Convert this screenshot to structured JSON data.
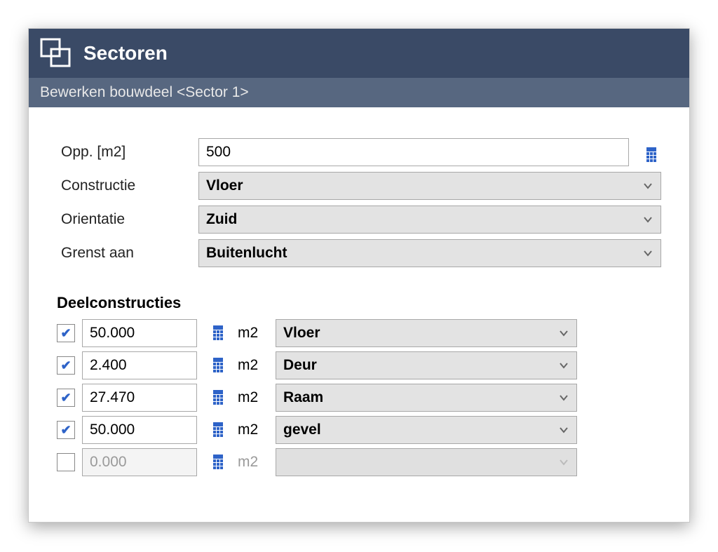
{
  "header": {
    "title": "Sectoren",
    "subtitle": "Bewerken bouwdeel <Sector 1>"
  },
  "form": {
    "opp_label": "Opp. [m2]",
    "opp_value": "500",
    "constructie_label": "Constructie",
    "constructie_value": "Vloer",
    "orientatie_label": "Orientatie",
    "orientatie_value": "Zuid",
    "grenst_label": "Grenst aan",
    "grenst_value": "Buitenlucht"
  },
  "deelconstructies": {
    "title": "Deelconstructies",
    "unit": "m2",
    "rows": [
      {
        "checked": true,
        "value": "50.000",
        "type": "Vloer"
      },
      {
        "checked": true,
        "value": "2.400",
        "type": "Deur"
      },
      {
        "checked": true,
        "value": "27.470",
        "type": "Raam"
      },
      {
        "checked": true,
        "value": "50.000",
        "type": "gevel"
      },
      {
        "checked": false,
        "value": "0.000",
        "type": ""
      }
    ]
  }
}
